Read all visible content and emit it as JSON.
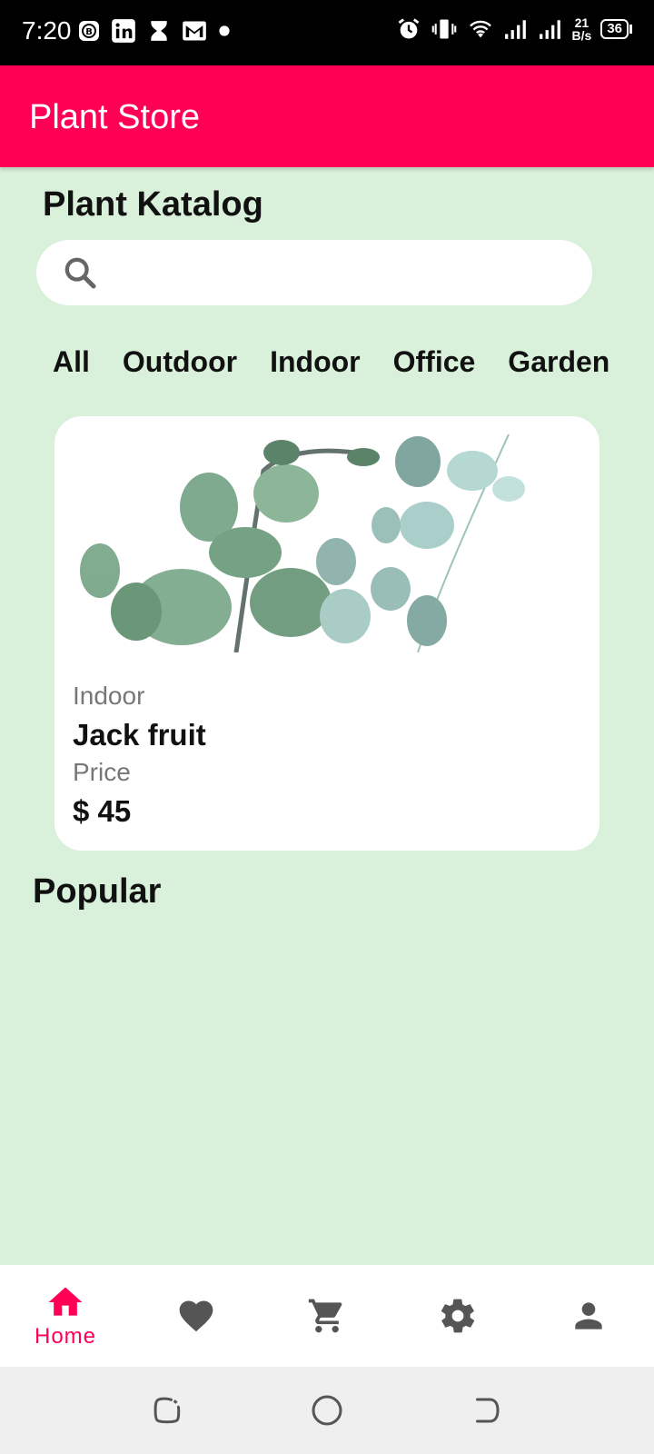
{
  "status_bar": {
    "time": "7:20",
    "net_speed_value": "21",
    "net_speed_unit": "B/s",
    "battery": "36"
  },
  "app_bar": {
    "title": "Plant Store"
  },
  "catalog": {
    "title": "Plant Katalog"
  },
  "search": {
    "placeholder": "",
    "value": ""
  },
  "categories": [
    "All",
    "Outdoor",
    "Indoor",
    "Office",
    "Garden"
  ],
  "products": [
    {
      "category": "Indoor",
      "name": "Jack fruit",
      "price_label": "Price",
      "price": "$ 45"
    }
  ],
  "popular": {
    "title": "Popular"
  },
  "bottom_nav": [
    {
      "icon": "home-icon",
      "label": "Home",
      "active": true
    },
    {
      "icon": "heart-icon",
      "label": "",
      "active": false
    },
    {
      "icon": "cart-icon",
      "label": "",
      "active": false
    },
    {
      "icon": "settings-icon",
      "label": "",
      "active": false
    },
    {
      "icon": "person-icon",
      "label": "",
      "active": false
    }
  ],
  "colors": {
    "primary": "#ff0055",
    "background": "#d9f0da",
    "nav_inactive": "#555555"
  }
}
